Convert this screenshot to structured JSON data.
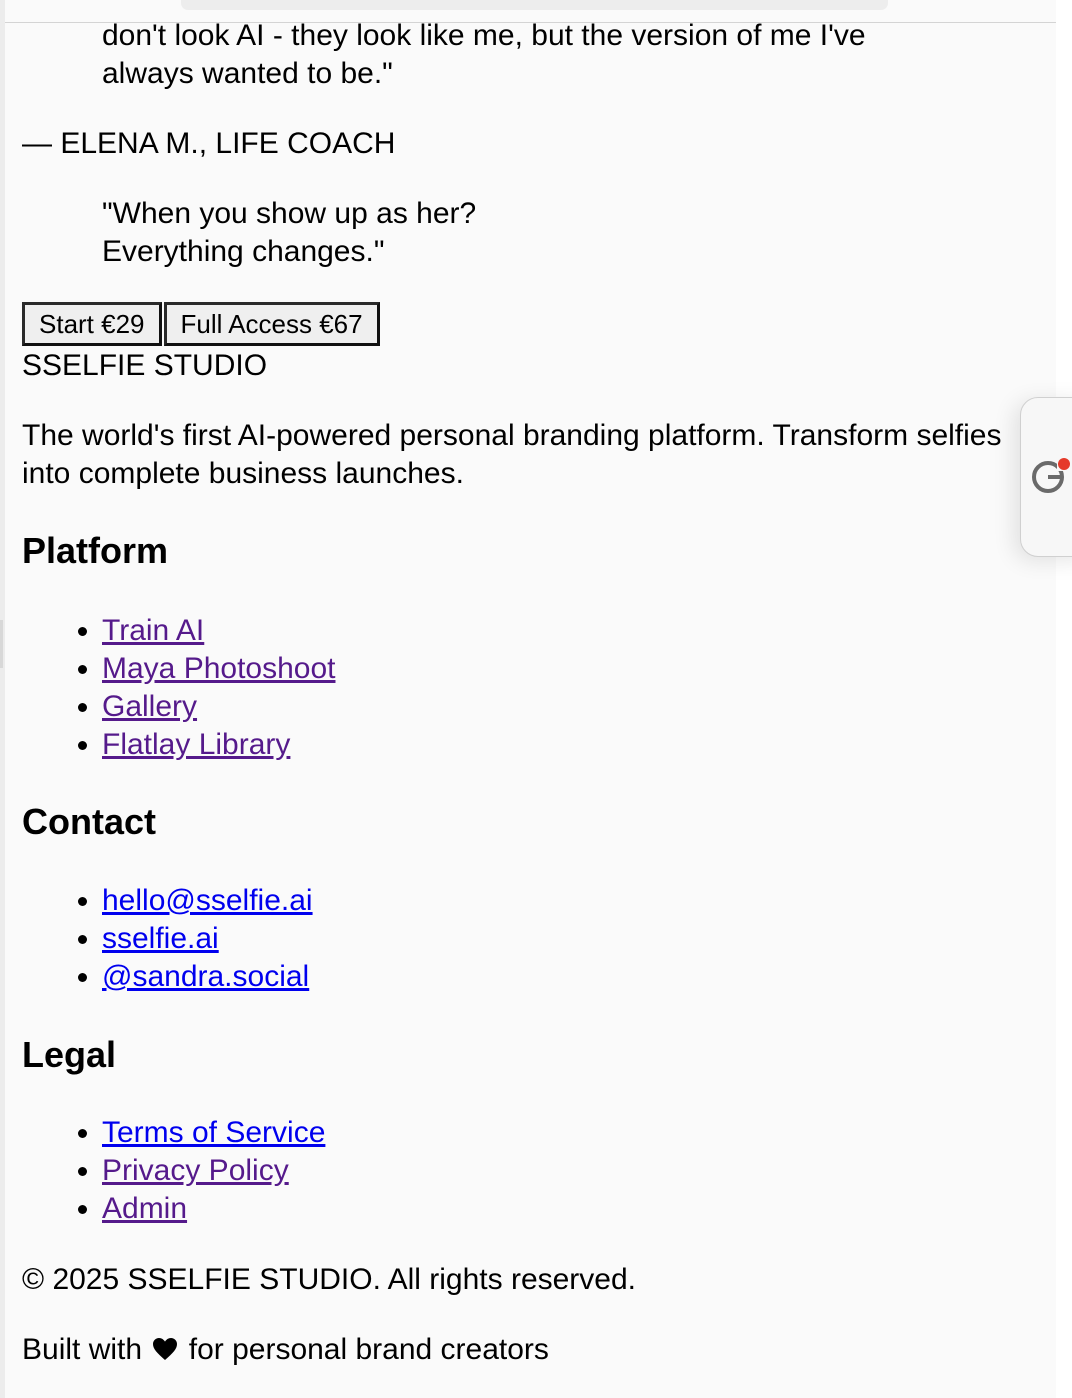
{
  "testimonial": {
    "quote_lines": [
      "don't look AI - they look like me, but the version of me I've",
      "always wanted to be.\""
    ],
    "attribution": "— ELENA M., LIFE COACH",
    "closing_lines": [
      "\"When you show up as her?",
      "Everything changes.\""
    ]
  },
  "cta": {
    "start_label": "Start €29",
    "full_access_label": "Full Access €67"
  },
  "footer": {
    "brand": "SSELFIE STUDIO",
    "tagline": "The world's first AI-powered personal branding platform. Transform selfies into complete business launches.",
    "platform": {
      "heading": "Platform",
      "links": [
        "Train AI",
        "Maya Photoshoot",
        "Gallery",
        "Flatlay Library"
      ]
    },
    "contact": {
      "heading": "Contact",
      "links": [
        "hello@sselfie.ai",
        "sselfie.ai",
        "@sandra.social"
      ]
    },
    "legal": {
      "heading": "Legal",
      "links": [
        "Terms of Service",
        "Privacy Policy",
        "Admin"
      ]
    },
    "copyright": "© 2025 SSELFIE STUDIO. All rights reserved.",
    "built_prefix": "Built with",
    "built_icon": "heart-icon",
    "built_suffix": "for personal brand creators"
  },
  "widget": {
    "icon": "grammar-assistant-icon",
    "badge_color": "#e53a2a"
  }
}
